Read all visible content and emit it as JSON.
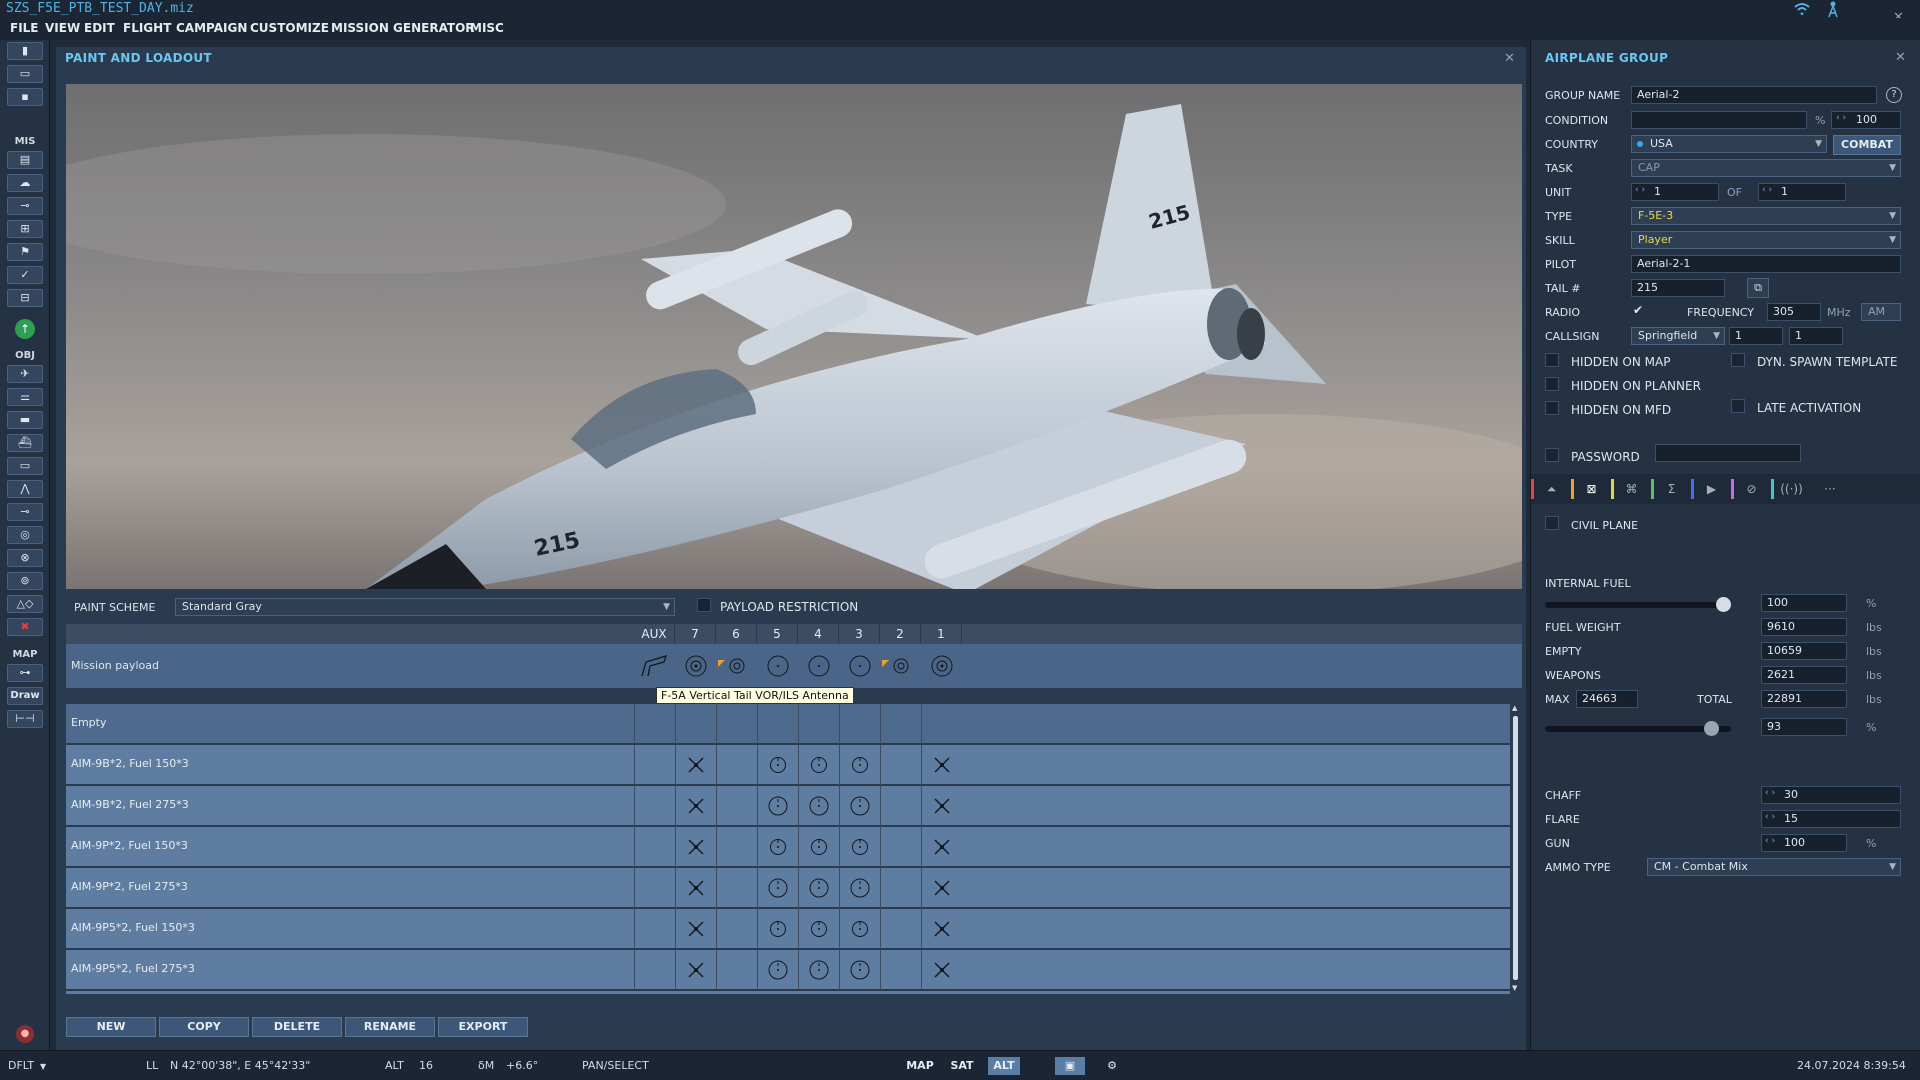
{
  "window_title": "SZS_F5E_PTB_TEST_DAY.miz",
  "menu": [
    "FILE",
    "VIEW",
    "EDIT",
    "FLIGHT",
    "CAMPAIGN",
    "CUSTOMIZE",
    "MISSION GENERATOR",
    "MISC"
  ],
  "toolbar": {
    "mis_label": "MIS",
    "obj_label": "OBJ",
    "map_label": "MAP",
    "draw_label": "Draw"
  },
  "paint_panel": {
    "title": "PAINT AND LOADOUT",
    "aircraft_tail": "215",
    "paint_scheme_label": "PAINT SCHEME",
    "paint_scheme_value": "Standard Gray",
    "payload_restriction_label": "PAYLOAD RESTRICTION",
    "stations": [
      "AUX",
      "7",
      "6",
      "5",
      "4",
      "3",
      "2",
      "1"
    ],
    "mission_payload_label": "Mission payload",
    "tooltip": "F-5A Vertical Tail VOR/ILS Antenna",
    "rows": [
      {
        "name": "Empty",
        "marks": [
          "",
          "",
          "",
          "",
          "",
          "",
          "",
          ""
        ]
      },
      {
        "name": "AIM-9B*2, Fuel 150*3",
        "marks": [
          "",
          "x",
          "",
          "o",
          "o",
          "o",
          "",
          "x"
        ]
      },
      {
        "name": "AIM-9B*2, Fuel 275*3",
        "marks": [
          "",
          "x",
          "",
          "O",
          "O",
          "O",
          "",
          "x"
        ]
      },
      {
        "name": "AIM-9P*2, Fuel 150*3",
        "marks": [
          "",
          "x",
          "",
          "o",
          "o",
          "o",
          "",
          "x"
        ]
      },
      {
        "name": "AIM-9P*2, Fuel 275*3",
        "marks": [
          "",
          "x",
          "",
          "O",
          "O",
          "O",
          "",
          "x"
        ]
      },
      {
        "name": "AIM-9P5*2, Fuel 150*3",
        "marks": [
          "",
          "x",
          "",
          "o",
          "o",
          "o",
          "",
          "x"
        ]
      },
      {
        "name": "AIM-9P5*2, Fuel 275*3",
        "marks": [
          "",
          "x",
          "",
          "O",
          "O",
          "O",
          "",
          "x"
        ]
      }
    ],
    "buttons": {
      "new": "NEW",
      "copy": "COPY",
      "delete": "DELETE",
      "rename": "RENAME",
      "export": "EXPORT"
    }
  },
  "group_panel": {
    "title": "AIRPLANE GROUP",
    "help": "?",
    "group_name_label": "GROUP NAME",
    "group_name": "Aerial-2",
    "condition_label": "CONDITION",
    "condition_unit": "%",
    "condition_value": "100",
    "country_label": "COUNTRY",
    "country": "USA",
    "combat_button": "COMBAT",
    "task_label": "TASK",
    "task": "CAP",
    "unit_label": "UNIT",
    "unit_value": "1",
    "of_label": "OF",
    "of_value": "1",
    "type_label": "TYPE",
    "type": "F-5E-3",
    "skill_label": "SKILL",
    "skill": "Player",
    "pilot_label": "PILOT",
    "pilot": "Aerial-2-1",
    "tail_label": "TAIL #",
    "tail": "215",
    "radio_label": "RADIO",
    "frequency_label": "FREQUENCY",
    "frequency": "305",
    "mhz": "MHz",
    "band": "AM",
    "callsign_label": "CALLSIGN",
    "callsign": "Springfield",
    "callsign_n1": "1",
    "callsign_n2": "1",
    "hidden_map": "HIDDEN ON MAP",
    "dyn_spawn": "DYN. SPAWN TEMPLATE",
    "hidden_planner": "HIDDEN ON PLANNER",
    "hidden_mfd": "HIDDEN ON MFD",
    "late_activation": "LATE ACTIVATION",
    "password": "PASSWORD",
    "civil_plane": "CIVIL PLANE",
    "internal_fuel_label": "INTERNAL FUEL",
    "internal_fuel": "100",
    "internal_fuel_fraction": 1.0,
    "fuel_weight_label": "FUEL WEIGHT",
    "fuel_weight": "9610",
    "empty_label": "EMPTY",
    "empty": "10659",
    "weapons_label": "WEAPONS",
    "weapons": "2621",
    "max_label": "MAX",
    "max": "24663",
    "total_label": "TOTAL",
    "total": "22891",
    "total_pct": "93",
    "total_fraction": 0.93,
    "lbs": "lbs",
    "pct": "%",
    "chaff_label": "CHAFF",
    "chaff": "30",
    "flare_label": "FLARE",
    "flare": "15",
    "gun_label": "GUN",
    "gun": "100",
    "ammo_label": "AMMO TYPE",
    "ammo": "CM - Combat Mix",
    "tab_colors": [
      "#e0474c",
      "#e8a23a",
      "#e0d44a",
      "#5ac25e",
      "#4a6fe0",
      "#c66be0",
      "#48c4c8"
    ]
  },
  "status": {
    "mode": "DFLT",
    "ll_label": "LL",
    "coords": "N 42°00'38\", E 45°42'33\"",
    "alt_label": "ALT",
    "alt": "16",
    "dm_label": "δM",
    "dm": "+6.6°",
    "pan": "PAN/SELECT",
    "map": "MAP",
    "sat": "SAT",
    "alt_btn": "ALT",
    "datetime": "24.07.2024 8:39:54"
  }
}
